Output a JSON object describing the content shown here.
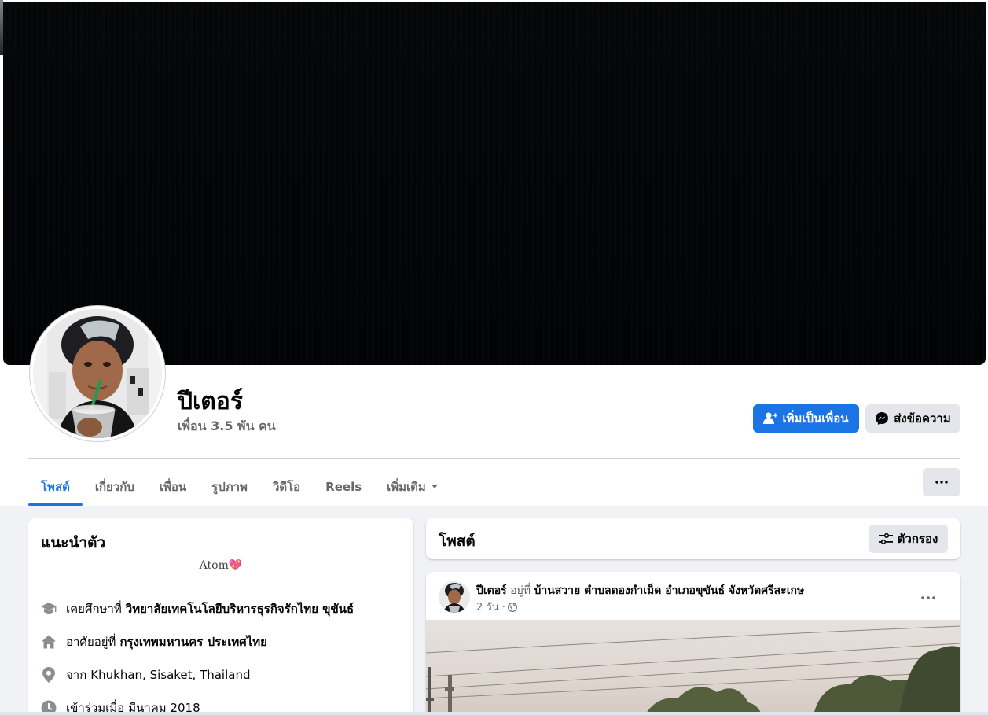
{
  "profile": {
    "name": "ปีเตอร์",
    "friends": "เพื่อน 3.5 พัน คน"
  },
  "actions": {
    "add_friend": "เพิ่มเป็นเพื่อน",
    "message": "ส่งข้อความ"
  },
  "tabs": [
    {
      "label": "โพสต์",
      "active": true
    },
    {
      "label": "เกี่ยวกับ"
    },
    {
      "label": "เพื่อน"
    },
    {
      "label": "รูปภาพ"
    },
    {
      "label": "วิดีโอ"
    },
    {
      "label": "Reels"
    },
    {
      "label": "เพิ่มเติม"
    }
  ],
  "intro": {
    "title": "แนะนำตัว",
    "bio": "Atom",
    "bio_emoji": "💖",
    "details": [
      {
        "icon": "graduation-cap-icon",
        "prefix": "เคยศึกษาที่",
        "value": "วิทยาลัยเทคโนโลยีบริหารธุรกิจรักไทย ขุขันธ์"
      },
      {
        "icon": "home-icon",
        "prefix": "อาศัยอยู่ที่",
        "value": "กรุงเทพมหานคร ประเทศไทย"
      },
      {
        "icon": "location-pin-icon",
        "prefix": "จาก",
        "value": "Khukhan, Sisaket, Thailand"
      },
      {
        "icon": "clock-icon",
        "prefix": "เข้าร่วมเมื่อ",
        "value": "มีนาคม 2018"
      }
    ]
  },
  "posts": {
    "title": "โพสต์",
    "filter_label": "ตัวกรอง"
  },
  "post": {
    "author": "ปีเตอร์",
    "at_text": "อยู่ที่",
    "location": "บ้านสวาย ตำบลดองกำเม็ด อำเภอขุขันธ์ จังหวัดศรีสะเกษ",
    "time": "2 วัน ·"
  },
  "colors": {
    "accent": "#1b74e4",
    "background": "#f0f2f5",
    "secondary_button": "#e4e6eb",
    "muted_text": "#65676b"
  }
}
